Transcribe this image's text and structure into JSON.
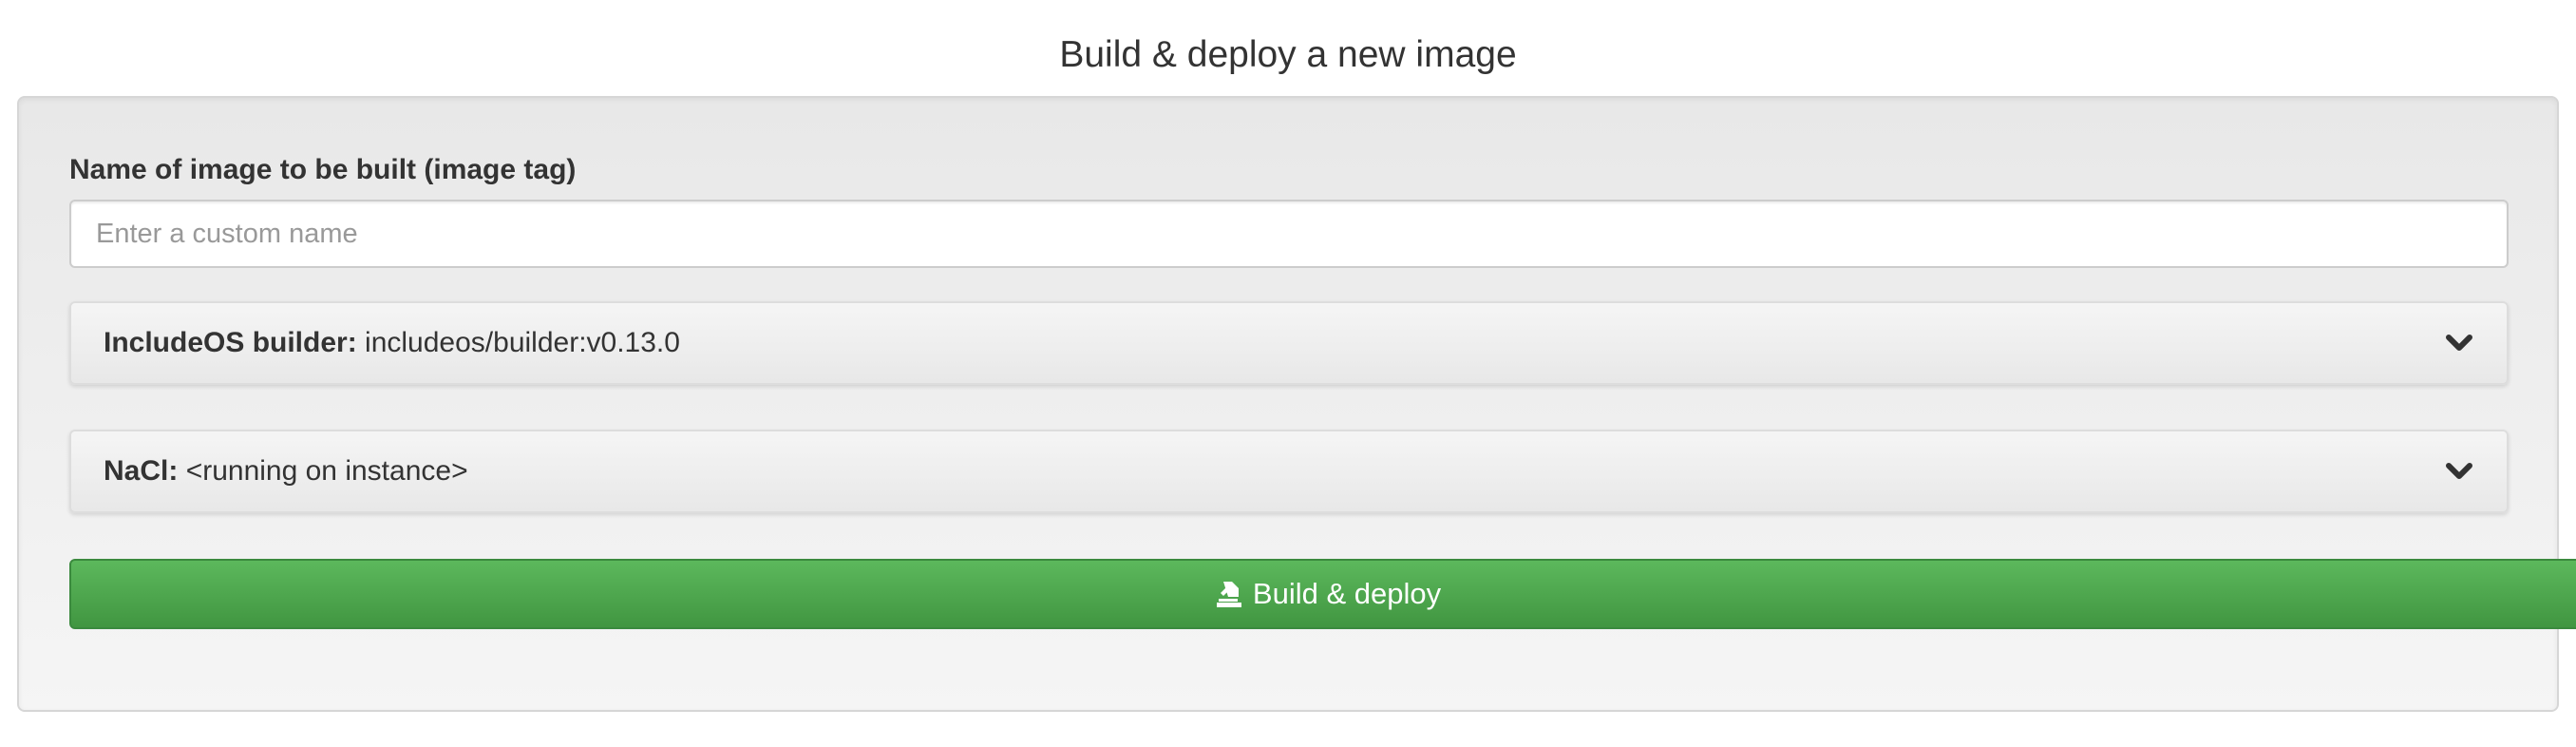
{
  "page": {
    "title": "Build & deploy a new image"
  },
  "form": {
    "image_name_label": "Name of image to be built (image tag)",
    "image_name_value": "",
    "image_name_placeholder": "Enter a custom name",
    "builder": {
      "key": "IncludeOS builder:",
      "value": "includeos/builder:v0.13.0",
      "icon": "chevron-down-icon"
    },
    "nacl": {
      "key": "NaCl:",
      "value": "<running on instance>",
      "icon": "chevron-down-icon"
    },
    "submit": {
      "label": "Build & deploy",
      "icon": "deploy-icon"
    }
  },
  "colors": {
    "button_green": "#5cb85c",
    "well_background": "#f5f5f5",
    "text": "#333333"
  }
}
